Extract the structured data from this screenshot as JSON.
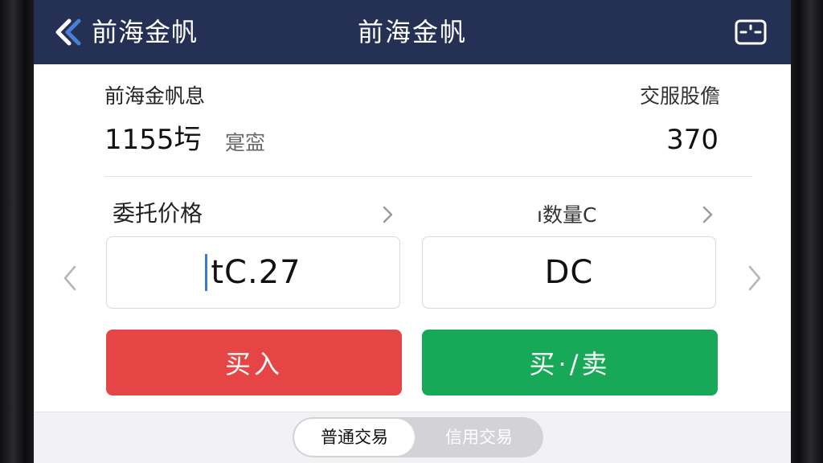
{
  "nav": {
    "back_label": "前海金帆",
    "title": "前海金帆",
    "icons": {
      "back": "chevron-left-icon",
      "menu": "window-icon"
    }
  },
  "info": {
    "left_label": "前海金帆息",
    "left_value": "1155圬",
    "left_unit": "寔寍",
    "right_label": "交服股儋",
    "right_value": "370"
  },
  "order": {
    "price_label": "委托价格",
    "qty_label": "ı数量C",
    "price_value": "tC.27",
    "qty_value": "DC"
  },
  "actions": {
    "buy_label": "买入",
    "sell_label": "买·/卖"
  },
  "mode_tabs": {
    "normal": "普通交易",
    "credit": "信用交易"
  },
  "colors": {
    "nav_bg": "#253055",
    "buy": "#e64545",
    "sell": "#17a957",
    "caret": "#3c78d8"
  }
}
